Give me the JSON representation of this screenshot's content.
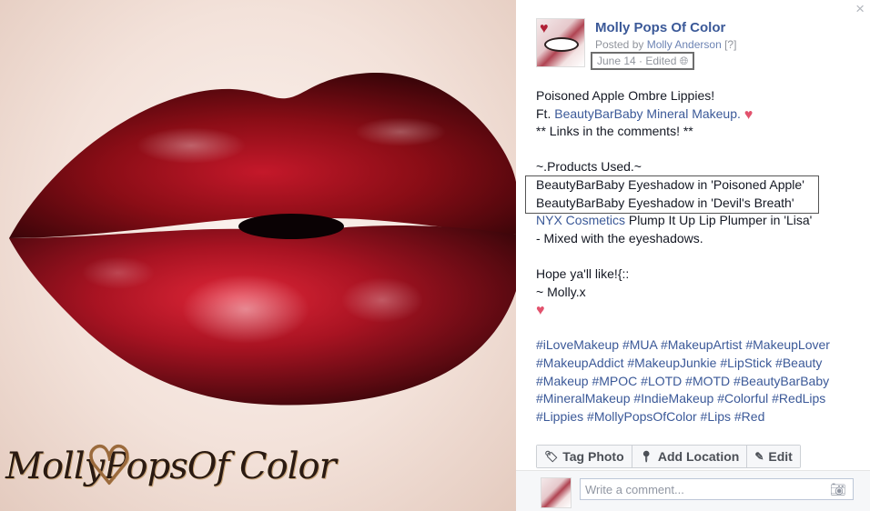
{
  "photo": {
    "alt": "glossy dark red lips",
    "watermark": "MollyPopsOf Color"
  },
  "panel": {
    "close_icon": "×",
    "page_name": "Molly Pops Of Color",
    "posted_prefix": "Posted by ",
    "posted_by": "Molly Anderson",
    "help": "[?]",
    "date": "June 14 · Edited",
    "globe_icon": "globe-icon"
  },
  "post": {
    "lines": [
      {
        "text": "Poisoned Apple Ombre Lippies!"
      },
      {
        "prefix": "Ft. ",
        "link": "BeautyBarBaby Mineral Makeup.",
        "heart": "♥"
      },
      {
        "text": "** Links in the comments! **"
      },
      {
        "text": ""
      },
      {
        "text": "~.Products Used.~"
      },
      {
        "text": "BeautyBarBaby Eyeshadow in 'Poisoned Apple'"
      },
      {
        "text": "BeautyBarBaby Eyeshadow in 'Devil's Breath'"
      },
      {
        "link": "NYX Cosmetics",
        "suffix": " Plump It Up Lip Plumper in 'Lisa'"
      },
      {
        "text": "- Mixed with the eyeshadows."
      },
      {
        "text": ""
      },
      {
        "text": "Hope ya'll like!{::"
      },
      {
        "text": "~ Molly.x"
      },
      {
        "heart": "♥"
      },
      {
        "text": ""
      }
    ],
    "hashtags": "#iLoveMakeup #MUA #MakeupArtist #MakeupLover #MakeupAddict #MakeupJunkie #LipStick #Beauty #Makeup #MPOC #LOTD #MOTD #BeautyBarBaby #MineralMakeup #IndieMakeup #Colorful #RedLips #Lippies #MollyPopsOfColor #Lips #Red"
  },
  "actions": {
    "tag_photo": "Tag Photo",
    "add_location": "Add Location",
    "edit": "Edit"
  },
  "comment": {
    "placeholder": "Write a comment...",
    "camera_icon": "camera-icon"
  },
  "colors": {
    "link": "#3b5998",
    "lip": "#7a0a10",
    "heart": "#e2526d"
  }
}
